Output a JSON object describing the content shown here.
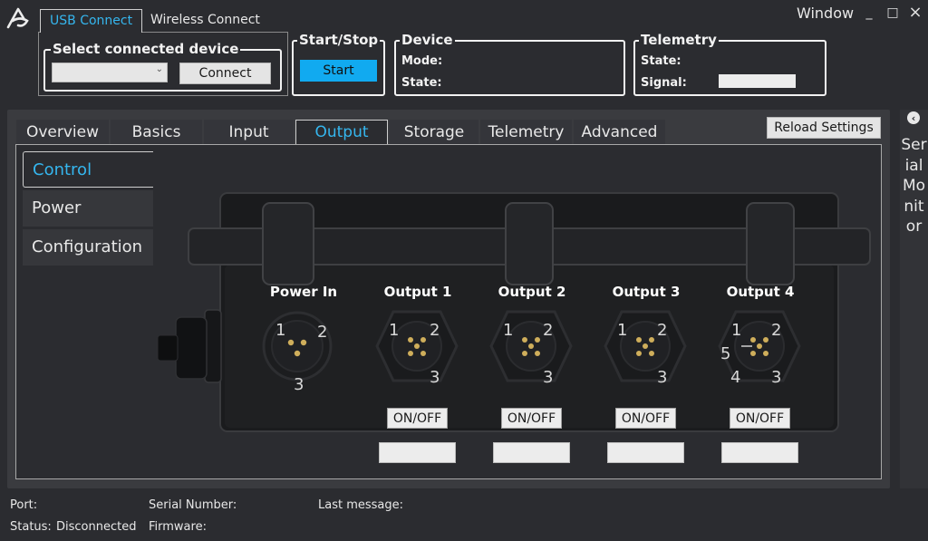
{
  "window": {
    "title": "Window",
    "minimize": "_",
    "maximize": "□",
    "close": "×"
  },
  "connection": {
    "tabs": [
      "USB Connect",
      "Wireless Connect"
    ],
    "active_tab": "USB Connect",
    "select_device": {
      "title": "Select connected device",
      "value": "",
      "connect_label": "Connect"
    }
  },
  "start_stop": {
    "title": "Start/Stop",
    "button": "Start"
  },
  "device": {
    "title": "Device",
    "mode_label": "Mode:",
    "mode_value": "",
    "state_label": "State:",
    "state_value": ""
  },
  "telemetry": {
    "title": "Telemetry",
    "state_label": "State:",
    "state_value": "",
    "signal_label": "Signal:",
    "signal_value": ""
  },
  "tabs": [
    "Overview",
    "Basics",
    "Input",
    "Output",
    "Storage",
    "Telemetry",
    "Advanced"
  ],
  "active_tab": "Output",
  "reload_label": "Reload Settings",
  "sidebar": {
    "items": [
      "Control",
      "Power",
      "Configuration"
    ],
    "active": "Control"
  },
  "serial_monitor": {
    "label": "Serial Monitor"
  },
  "ports": [
    {
      "label": "Power In",
      "pins": [
        "1",
        "2",
        "3"
      ],
      "button": null,
      "value": null
    },
    {
      "label": "Output 1",
      "pins": [
        "1",
        "2",
        "3"
      ],
      "button": "ON/OFF",
      "value": ""
    },
    {
      "label": "Output 2",
      "pins": [
        "1",
        "2",
        "3"
      ],
      "button": "ON/OFF",
      "value": ""
    },
    {
      "label": "Output 3",
      "pins": [
        "1",
        "2",
        "3"
      ],
      "button": "ON/OFF",
      "value": ""
    },
    {
      "label": "Output 4",
      "pins": [
        "1",
        "2",
        "5",
        "4",
        "3"
      ],
      "button": "ON/OFF",
      "value": ""
    }
  ],
  "status": {
    "port_label": "Port:",
    "port_value": "",
    "status_label": "Status:",
    "status_value": "Disconnected",
    "serial_label": "Serial Number:",
    "serial_value": "",
    "firmware_label": "Firmware:",
    "firmware_value": "",
    "last_message_label": "Last message:",
    "last_message_value": ""
  },
  "colors": {
    "accent": "#35b6ee",
    "start_button": "#11aaf0",
    "background": "#2b2c30"
  }
}
